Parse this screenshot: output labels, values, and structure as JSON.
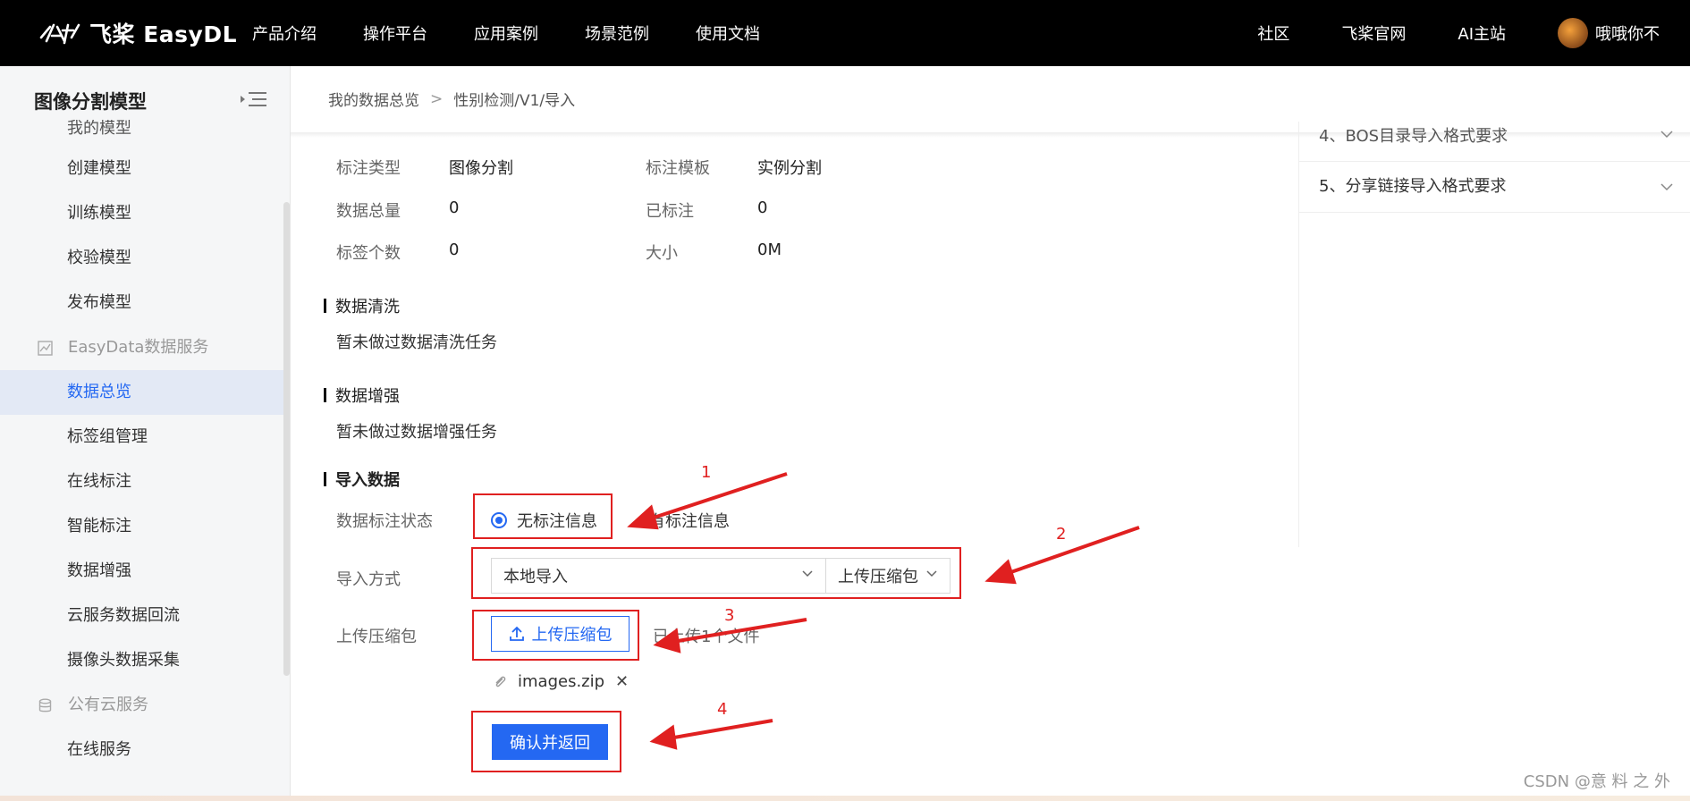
{
  "topbar": {
    "logo_text": "飞桨 EasyDL",
    "nav": [
      "产品介绍",
      "操作平台",
      "应用案例",
      "场景范例",
      "使用文档"
    ],
    "nav_right": [
      "社区",
      "飞桨官网",
      "AI主站"
    ],
    "username": "哦哦你不"
  },
  "sidebar": {
    "title": "图像分割模型",
    "items_top": [
      {
        "label": "我的模型",
        "partial": true
      },
      {
        "label": "创建模型"
      },
      {
        "label": "训练模型"
      },
      {
        "label": "校验模型"
      },
      {
        "label": "发布模型"
      }
    ],
    "group_easydata": "EasyData数据服务",
    "items_data": [
      {
        "label": "数据总览",
        "active": true
      },
      {
        "label": "标签组管理"
      },
      {
        "label": "在线标注"
      },
      {
        "label": "智能标注"
      },
      {
        "label": "数据增强"
      },
      {
        "label": "云服务数据回流"
      },
      {
        "label": "摄像头数据采集"
      }
    ],
    "group_cloud": "公有云服务",
    "items_cloud": [
      {
        "label": "在线服务"
      }
    ]
  },
  "breadcrumb": {
    "root": "我的数据总览",
    "separator": ">",
    "current": "性别检测/V1/导入"
  },
  "info": {
    "annot_type_label": "标注类型",
    "annot_type_value": "图像分割",
    "template_label": "标注模板",
    "template_value": "实例分割",
    "total_label": "数据总量",
    "total_value": "0",
    "labeled_label": "已标注",
    "labeled_value": "0",
    "tags_label": "标签个数",
    "tags_value": "0",
    "size_label": "大小",
    "size_value": "0M"
  },
  "sections": {
    "clean_title": "数据清洗",
    "clean_desc": "暂未做过数据清洗任务",
    "augment_title": "数据增强",
    "augment_desc": "暂未做过数据增强任务",
    "import_title": "导入数据"
  },
  "form": {
    "status_label": "数据标注状态",
    "radio_no_label": "无标注信息",
    "radio_has_label": "有标注信息",
    "method_label": "导入方式",
    "method_select": "本地导入",
    "method_sub_select": "上传压缩包",
    "upload_label": "上传压缩包",
    "upload_button": "上传压缩包",
    "upload_hint": "已上传1个文件",
    "file_name": "images.zip",
    "file_remove": "✕",
    "confirm_button": "确认并返回"
  },
  "annotations": [
    "1",
    "2",
    "3",
    "4"
  ],
  "right_panel": {
    "items": [
      {
        "label": "4、BOS目录导入格式要求",
        "partial": true
      },
      {
        "label": "5、分享链接导入格式要求"
      }
    ]
  },
  "watermark": "CSDN @意 料 之 外",
  "colors": {
    "primary": "#2468f2",
    "annotation_red": "#e02020",
    "topbar": "#000000",
    "sidebar_active_bg": "#e3e9f5"
  }
}
